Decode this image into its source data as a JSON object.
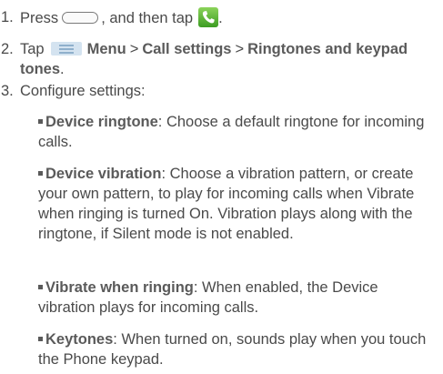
{
  "steps": [
    {
      "number": "1.",
      "before": "Press",
      "middle": ", and then tap",
      "after": "."
    },
    {
      "number": "2.",
      "tap": "Tap",
      "menu": "Menu",
      "sep1": ">",
      "call_settings": "Call settings",
      "sep2": ">",
      "ringtones": "Ringtones and keypad tones",
      "end": "."
    },
    {
      "number": "3.",
      "text": "Configure settings:"
    }
  ],
  "settings": [
    {
      "term": "Device ringtone",
      "desc": ": Choose a default ringtone for incoming calls."
    },
    {
      "term": "Device vibration",
      "desc": ": Choose a vibration pattern, or create your own pattern, to play for incoming calls when Vibrate when ringing is turned On. Vibration plays along with the ringtone, if Silent mode is not enabled."
    },
    {
      "term": "Vibrate when ringing",
      "desc": ": When enabled, the Device vibration plays for incoming calls."
    },
    {
      "term": "Keytones",
      "desc": ": When turned on, sounds play when you touch the Phone keypad."
    }
  ],
  "icons": {
    "home_key": "home-key-icon",
    "phone_app": "phone-app-icon",
    "menu_key": "menu-key-icon"
  },
  "colors": {
    "text": "#4a4a4a",
    "phone_icon": "#4aa82c",
    "menu_key": "#d4e3f0"
  }
}
